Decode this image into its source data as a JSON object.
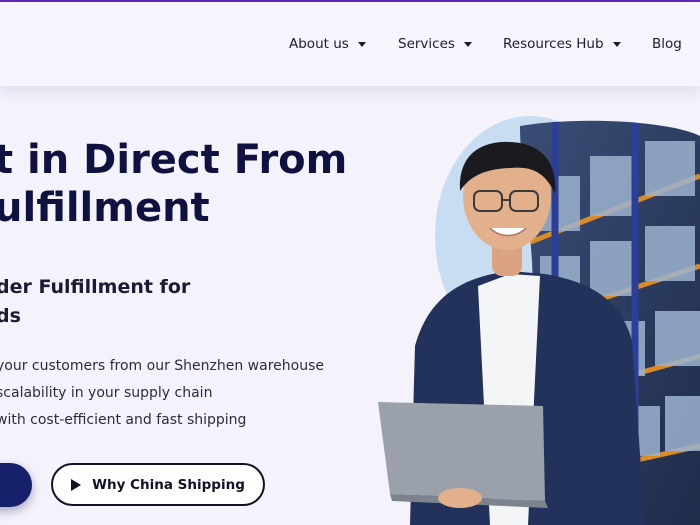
{
  "header": {
    "nav": [
      {
        "label": "About us",
        "has_caret": true
      },
      {
        "label": "Services",
        "has_caret": true
      },
      {
        "label": "Resources Hub",
        "has_caret": true
      },
      {
        "label": "Blog",
        "has_caret": false
      }
    ]
  },
  "hero": {
    "title_line1": "t in Direct From",
    "title_line2": "ulfillment",
    "subtitle_line1": "der Fulfillment for",
    "subtitle_line2": "ds",
    "bullets": [
      "your customers from our Shenzhen warehouse",
      "scalability in your supply chain",
      "with cost-efficient and fast shipping"
    ],
    "secondary_button": "Why China Shipping"
  },
  "colors": {
    "accent_purple": "#5b2bb5",
    "navy": "#17206a",
    "title": "#0f1240",
    "background": "#f4f2fb"
  }
}
